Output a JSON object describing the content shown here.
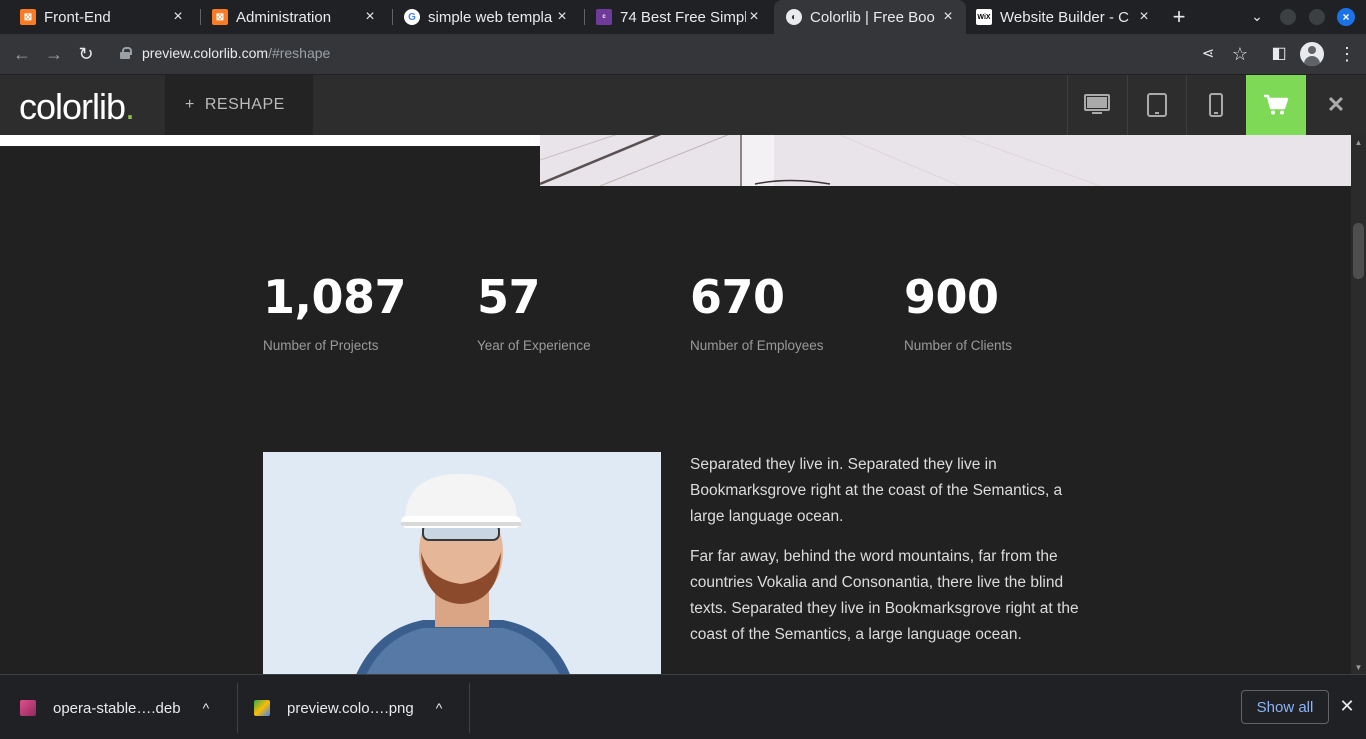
{
  "browser": {
    "tabs": [
      {
        "title": "Front-End",
        "favicon": "xampp-icon",
        "color": "#fb7a24"
      },
      {
        "title": "Administration",
        "favicon": "xampp-icon",
        "color": "#fb7a24"
      },
      {
        "title": "simple web templa",
        "favicon": "google-icon",
        "color": "#ffffff"
      },
      {
        "title": "74 Best Free Simple",
        "favicon": "colorlib-icon",
        "color": "#6e3b9b"
      },
      {
        "title": "Colorlib | Free Boo",
        "favicon": "globe-icon",
        "color": "#e8eaed"
      },
      {
        "title": "Website Builder - C",
        "favicon": "wix-icon",
        "color": "#ffffff"
      }
    ],
    "new_tab_symbol": "+",
    "url_host": "preview.colorlib.com",
    "url_path": "/#reshape"
  },
  "colorlib_bar": {
    "logo": "colorlib",
    "logo_dot": ".",
    "theme_plus": "+",
    "theme_name": "RESHAPE",
    "accent": "#7ed957"
  },
  "page": {
    "stats": [
      {
        "number": "1,087",
        "label": "Number of Projects"
      },
      {
        "number": "57",
        "label": "Year of Experience"
      },
      {
        "number": "670",
        "label": "Number of Employees"
      },
      {
        "number": "900",
        "label": "Number of Clients"
      }
    ],
    "paragraphs": [
      "Separated they live in. Separated they live in Bookmarksgrove right at the coast of the Semantics, a large language ocean.",
      "Far far away, behind the word mountains, far from the countries Vokalia and Consonantia, there live the blind texts. Separated they live in Bookmarksgrove right at the coast of the Semantics, a large language ocean."
    ]
  },
  "downloads": {
    "items": [
      {
        "name": "opera-stable….deb"
      },
      {
        "name": "preview.colo….png"
      }
    ],
    "show_all": "Show all"
  }
}
